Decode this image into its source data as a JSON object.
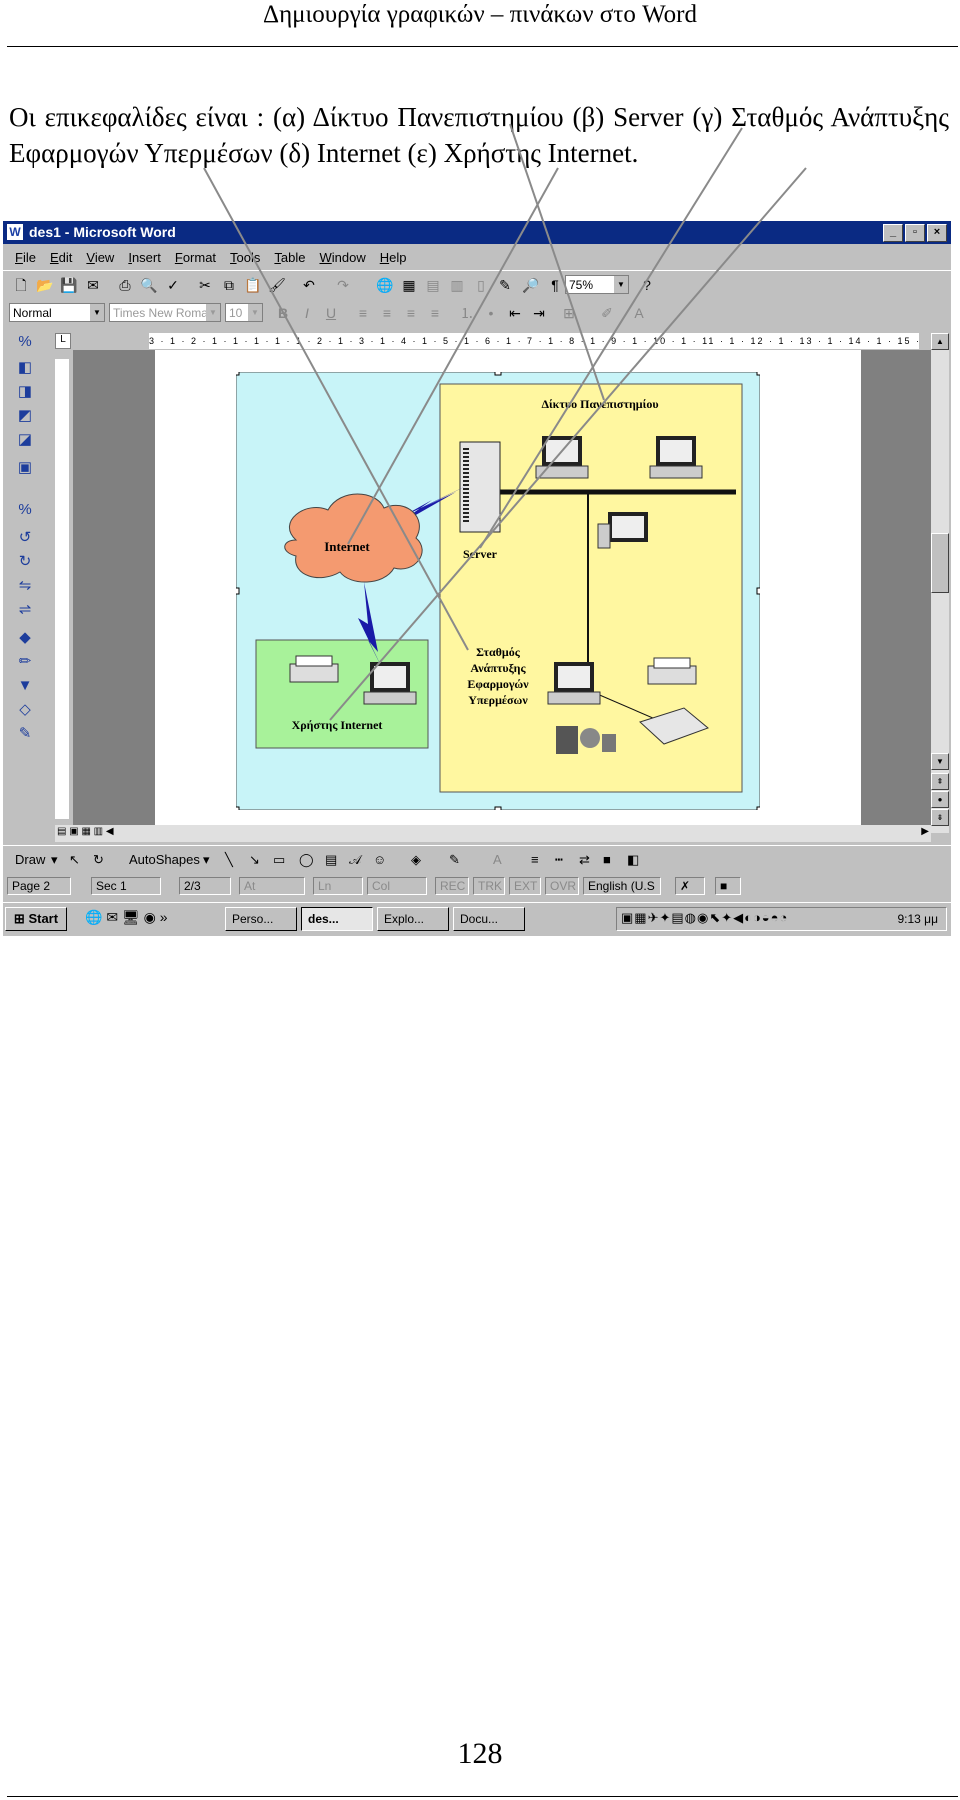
{
  "header": {
    "title": "Δημιουργία γραφικών – πινάκων στο Word"
  },
  "intro": {
    "text": "Οι επικεφαλίδες είναι : (α) Δίκτυο Πανεπιστημίου (β) Server (γ) Σταθμός Ανάπτυξης Εφαρμογών Υπερμέσων (δ) Internet (ε) Χρήστης Internet."
  },
  "word_window": {
    "title": "des1 - Microsoft Word",
    "menu": [
      "File",
      "Edit",
      "View",
      "Insert",
      "Format",
      "Tools",
      "Table",
      "Window",
      "Help"
    ],
    "zoom": "75%",
    "style": "Normal",
    "font": "Times New Roman",
    "size": "10",
    "ruler_text": "3 · 1 · 2 · 1 · 1 · 1 · 1 · 1 · 2 · 1 · 3 · 1 · 4 · 1 · 5 · 1 · 6 · 1 · 7 · 1 · 8 · 1 · 9 · 1 · 10 · 1 · 11 · 1 · 12 · 1 · 13 · 1 · 14 · 1 · 15 · 1 · 16 · 1 · 17 ·",
    "draw_toolbar": {
      "draw": "Draw",
      "autoshapes": "AutoShapes"
    },
    "status": {
      "page": "Page 2",
      "sec": "Sec 1",
      "pages": "2/3",
      "at": "At",
      "ln": "Ln",
      "col": "Col",
      "rec": "REC",
      "trk": "TRK",
      "ext": "EXT",
      "ovr": "OVR",
      "lang": "English (U.S"
    },
    "taskbar": {
      "start": "Start",
      "tasks": [
        "Perso...",
        "des...",
        "Explo...",
        "Docu..."
      ],
      "clock": "9:13 μμ"
    }
  },
  "diagram": {
    "network_label": "Δίκτυο Πανεπιστημίου",
    "server_label": "Server",
    "internet_label": "Internet",
    "station_label": [
      "Σταθμός",
      "Ανάπτυξης",
      "Εφαρμογών",
      "Υπερμέσων"
    ],
    "user_label": "Χρήστης Internet",
    "colors": {
      "canvas": "#c8f4f8",
      "network": "#fff7a0",
      "user": "#a8f29a",
      "cloud": "#f49a70",
      "bolt": "#1a1aa8"
    }
  },
  "page_number": "128"
}
